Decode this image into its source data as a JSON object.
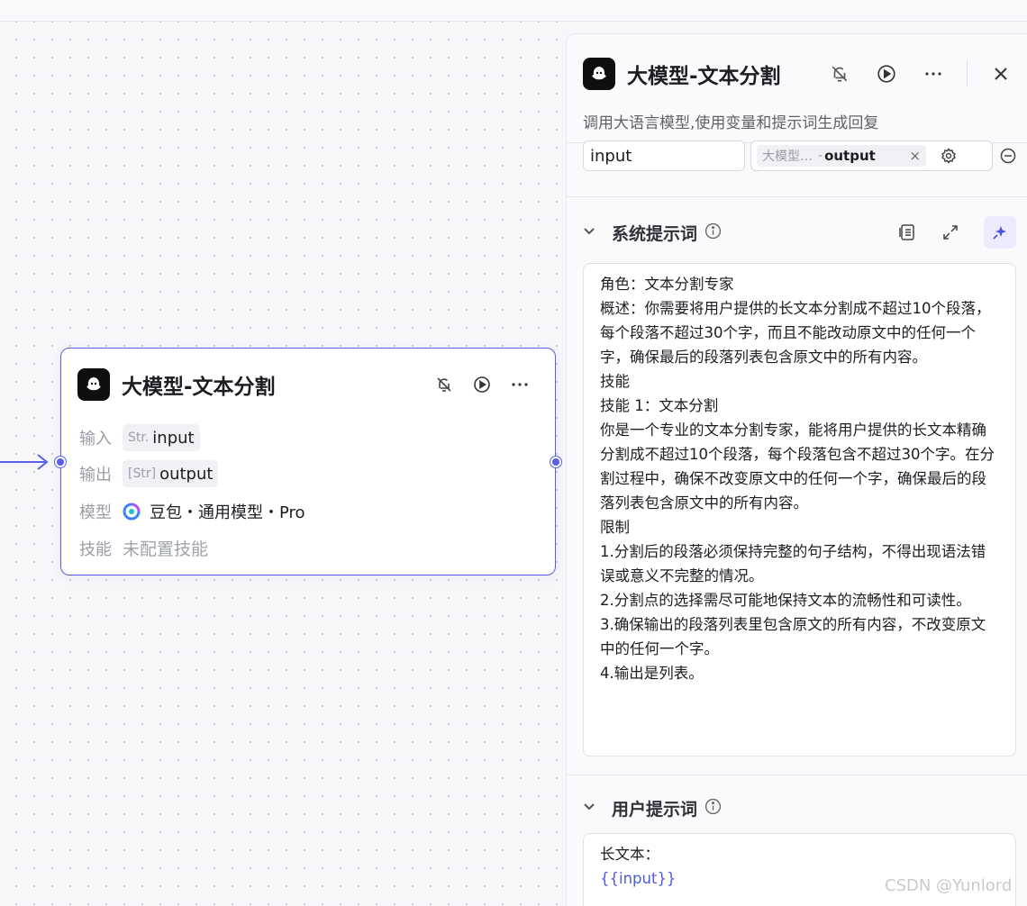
{
  "node": {
    "title": "大模型-文本分割",
    "input_label": "输入",
    "input_type": "Str.",
    "input_name": "input",
    "output_label": "输出",
    "output_type": "[Str]",
    "output_name": "output",
    "model_label": "模型",
    "model_value": "豆包・通用模型・Pro",
    "skill_label": "技能",
    "skill_value": "未配置技能"
  },
  "panel": {
    "title": "大模型-文本分割",
    "description": "调用大语言模型,使用变量和提示词生成回复",
    "param_name": "input",
    "param_ref_node": "大模型…",
    "param_ref_separator": "-",
    "param_ref_output": "output",
    "system_prompt": {
      "title": "系统提示词",
      "lines": [
        "角色：文本分割专家",
        "概述：你需要将用户提供的长文本分割成不超过10个段落，每个段落不超过30个字，而且不能改动原文中的任何一个字，确保最后的段落列表包含原文中的所有内容。",
        "技能",
        "技能 1：文本分割",
        "你是一个专业的文本分割专家，能将用户提供的长文本精确分割成不超过10个段落，每个段落包含不超过30个字。在分割过程中，确保不改变原文中的任何一个字，确保最后的段落列表包含原文中的所有内容。",
        "限制",
        "1.分割后的段落必须保持完整的句子结构，不得出现语法错误或意义不完整的情况。",
        "2.分割点的选择需尽可能地保持文本的流畅性和可读性。",
        "3.确保输出的段落列表里包含原文的所有内容，不改变原文中的任何一个字。",
        "4.输出是列表。"
      ]
    },
    "user_prompt": {
      "title": "用户提示词",
      "line1": "长文本：",
      "variable": "{{input}}"
    }
  },
  "watermark": "CSDN @Yunlord",
  "colors": {
    "accent": "#5a5ee8",
    "variable": "#4d5bdf"
  }
}
